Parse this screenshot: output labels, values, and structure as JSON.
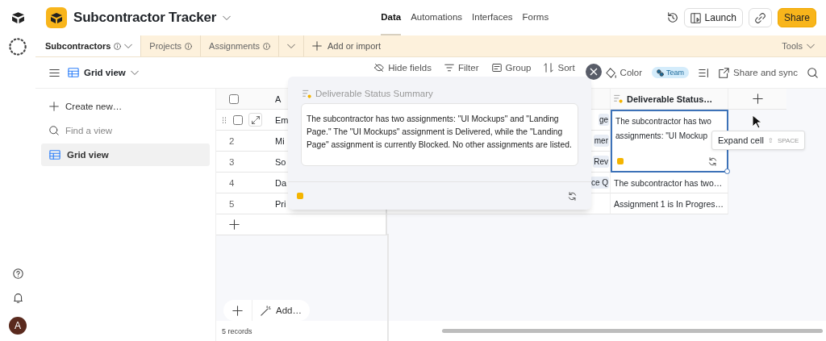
{
  "app": {
    "title": "Subcontractor Tracker"
  },
  "nav": [
    {
      "label": "Data",
      "selected": true
    },
    {
      "label": "Automations",
      "selected": false
    },
    {
      "label": "Interfaces",
      "selected": false
    },
    {
      "label": "Forms",
      "selected": false
    }
  ],
  "header_buttons": {
    "launch": "Launch",
    "share": "Share"
  },
  "tables": [
    {
      "label": "Subcontractors",
      "selected": true
    },
    {
      "label": "Projects",
      "selected": false
    },
    {
      "label": "Assignments",
      "selected": false
    }
  ],
  "add_or_import": "Add or import",
  "tools": "Tools",
  "view": {
    "name": "Grid view"
  },
  "toolbar": [
    "Hide fields",
    "Filter",
    "Group",
    "Sort"
  ],
  "color_button": "Color",
  "team_chip": "Team",
  "share_sync": "Share and sync",
  "sidebar": {
    "create": "Create new…",
    "find_placeholder": "Find a view",
    "views": [
      {
        "label": "Grid view",
        "selected": true
      }
    ]
  },
  "avatar": "A",
  "grid": {
    "all_checked": false,
    "primary_type_glyph": "A",
    "deliverable_header": "Deliverable Status…",
    "rows": [
      {
        "hovered": true,
        "selected": true,
        "primary": "Em",
        "linked": "ge",
        "deliverable": "The subcontractor has two assignments: \"UI Mockup"
      },
      {
        "hovered": false,
        "selected": false,
        "number": "2",
        "primary": "Mi",
        "linked": "mer"
      },
      {
        "hovered": false,
        "selected": false,
        "number": "3",
        "primary": "So",
        "linked": "Rev"
      },
      {
        "hovered": false,
        "selected": false,
        "number": "4",
        "primary": "Da",
        "linked": "ce Q",
        "deliverable": "The subcontractor has two…"
      },
      {
        "hovered": false,
        "selected": false,
        "number": "5",
        "primary": "Pri",
        "deliverable": "Assignment 1 is In Progres…"
      }
    ],
    "add_label": "Add…",
    "record_count": "5 records"
  },
  "popup": {
    "title": "Deliverable Status Summary",
    "text": "The subcontractor has two assignments: \"UI Mockups\" and \"Landing Page.\" The \"UI Mockups\" assignment is Delivered, while the \"Landing Page\" assignment is currently Blocked. No other assignments are listed."
  },
  "tooltip": {
    "label": "Expand cell",
    "shift": "⇧",
    "key": "SPACE"
  }
}
